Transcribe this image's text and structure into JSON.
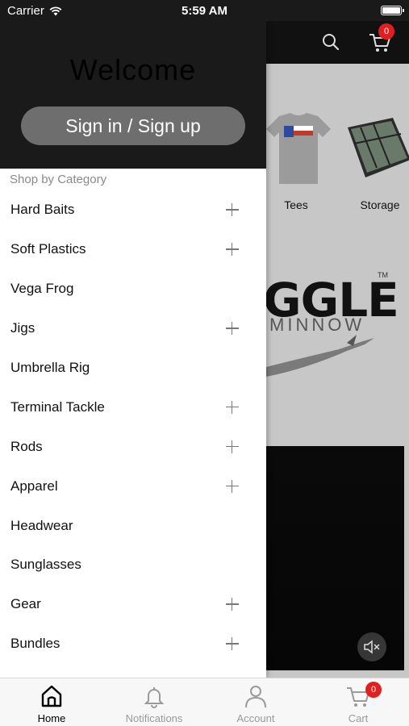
{
  "status_bar": {
    "carrier": "Carrier",
    "time": "5:59 AM"
  },
  "header": {
    "cart_count": "0"
  },
  "background": {
    "tiles": [
      {
        "label": "Tees"
      },
      {
        "label": "Storage"
      }
    ],
    "banner_text": "GGLE",
    "banner_sub": "MINNOW",
    "banner_tm": "TM"
  },
  "drawer": {
    "welcome": "Welcome",
    "signin_label": "Sign in / Sign up",
    "section_title": "Shop by Category",
    "categories": [
      {
        "label": "Hard Baits",
        "expandable": true
      },
      {
        "label": "Soft Plastics",
        "expandable": true
      },
      {
        "label": "Vega Frog",
        "expandable": false
      },
      {
        "label": "Jigs",
        "expandable": true
      },
      {
        "label": "Umbrella Rig",
        "expandable": false
      },
      {
        "label": "Terminal Tackle",
        "expandable": true
      },
      {
        "label": "Rods",
        "expandable": true
      },
      {
        "label": "Apparel",
        "expandable": true
      },
      {
        "label": "Headwear",
        "expandable": false
      },
      {
        "label": "Sunglasses",
        "expandable": false
      },
      {
        "label": "Gear",
        "expandable": true
      },
      {
        "label": "Bundles",
        "expandable": true
      }
    ]
  },
  "tabbar": {
    "tabs": [
      {
        "label": "Home",
        "icon": "home-icon",
        "active": true
      },
      {
        "label": "Notifications",
        "icon": "bell-icon",
        "active": false
      },
      {
        "label": "Account",
        "icon": "user-icon",
        "active": false
      },
      {
        "label": "Cart",
        "icon": "cart-icon",
        "active": false
      }
    ],
    "cart_count": "0"
  },
  "colors": {
    "badge": "#e02020",
    "drawer_header": "#1a1a1a",
    "signin_button": "#6e6e6e"
  }
}
